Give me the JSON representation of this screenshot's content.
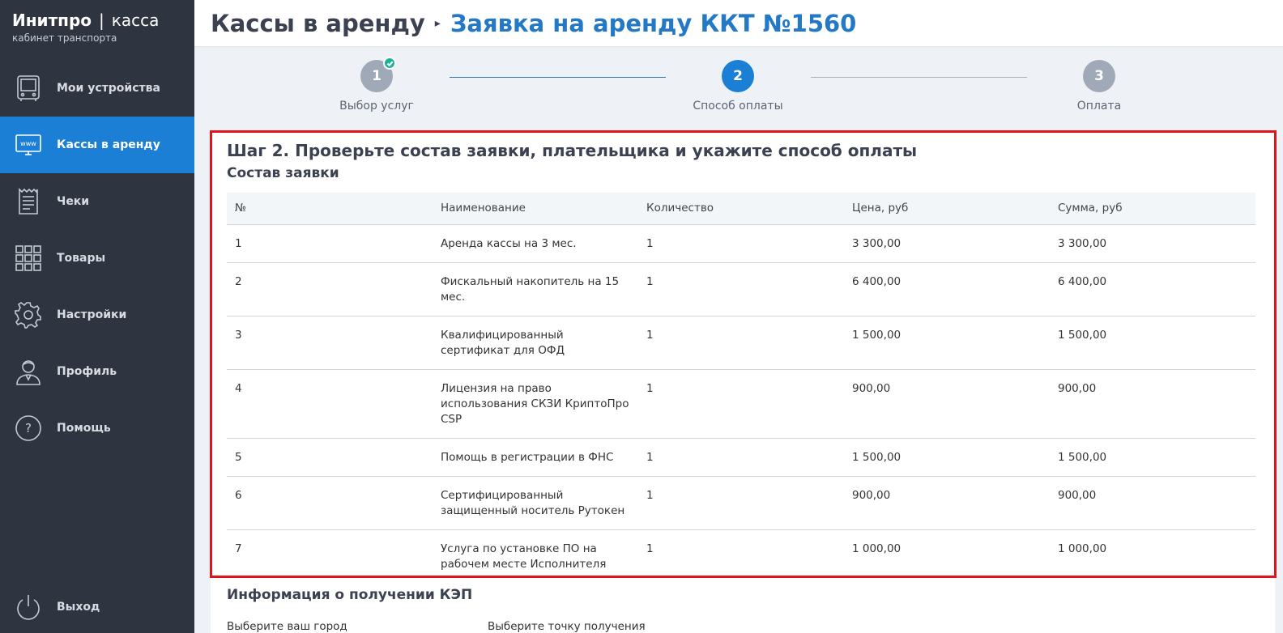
{
  "sidebar": {
    "brand": {
      "name": "Инитпро",
      "separator": "|",
      "product": "касса",
      "subtitle": "кабинет транспорта"
    },
    "items": [
      {
        "label": "Мои устройства",
        "icon": "device-icon",
        "active": false
      },
      {
        "label": "Кассы в аренду",
        "icon": "www-monitor-icon",
        "active": true
      },
      {
        "label": "Чеки",
        "icon": "receipt-icon",
        "active": false
      },
      {
        "label": "Товары",
        "icon": "grid-icon",
        "active": false
      },
      {
        "label": "Настройки",
        "icon": "gear-icon",
        "active": false
      },
      {
        "label": "Профиль",
        "icon": "user-icon",
        "active": false
      },
      {
        "label": "Помощь",
        "icon": "help-icon",
        "active": false
      }
    ],
    "logout": {
      "label": "Выход",
      "icon": "power-icon"
    }
  },
  "header": {
    "root": "Кассы в аренду",
    "separator_icon": "chevron-right-icon",
    "current": "Заявка на аренду ККТ №1560"
  },
  "stepper": {
    "steps": [
      {
        "number": "1",
        "label": "Выбор услуг",
        "state": "done"
      },
      {
        "number": "2",
        "label": "Способ оплаты",
        "state": "active"
      },
      {
        "number": "3",
        "label": "Оплата",
        "state": "pending"
      }
    ]
  },
  "main": {
    "step_title": "Шаг 2. Проверьте состав заявки, плательщика и укажите способ оплаты",
    "section_title": "Состав заявки",
    "table": {
      "headers": [
        "№",
        "Наименование",
        "Количество",
        "Цена, руб",
        "Сумма, руб"
      ],
      "rows": [
        [
          "1",
          "Аренда кассы на 3 мес.",
          "1",
          "3 300,00",
          "3 300,00"
        ],
        [
          "2",
          "Фискальный накопитель на 15 мес.",
          "1",
          "6 400,00",
          "6 400,00"
        ],
        [
          "3",
          "Квалифицированный сертификат для ОФД",
          "1",
          "1 500,00",
          "1 500,00"
        ],
        [
          "4",
          "Лицензия на право использования СКЗИ КриптоПро CSP",
          "1",
          "900,00",
          "900,00"
        ],
        [
          "5",
          "Помощь в регистрации в ФНС",
          "1",
          "1 500,00",
          "1 500,00"
        ],
        [
          "6",
          "Сертифицированный защищенный носитель Рутокен",
          "1",
          "900,00",
          "900,00"
        ],
        [
          "7",
          "Услуга по установке ПО на рабочем месте Исполнителя",
          "1",
          "1 000,00",
          "1 000,00"
        ]
      ]
    },
    "kep": {
      "title": "Информация о получении КЭП",
      "city_label": "Выберите ваш город",
      "point_label": "Выберите точку получения"
    }
  },
  "colors": {
    "sidebar_bg": "#2f3441",
    "accent": "#1b7fd6",
    "highlight": "#e3121b",
    "success": "#1ab394"
  }
}
